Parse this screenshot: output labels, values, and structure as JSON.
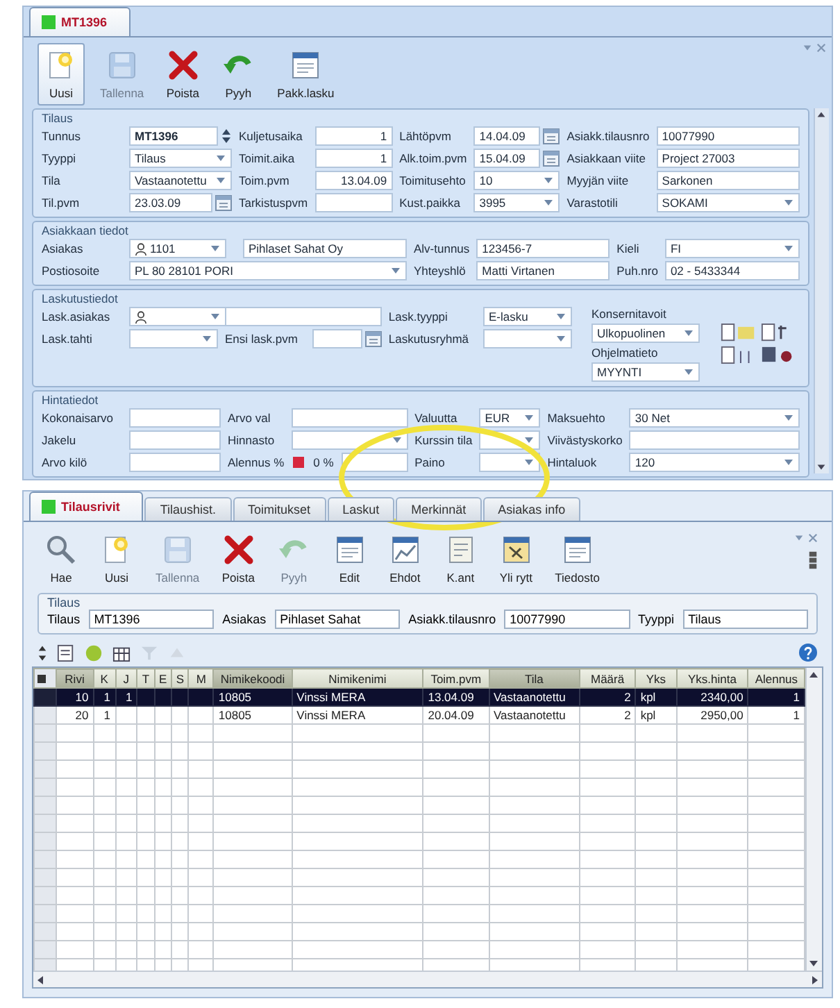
{
  "document_tabs": [
    {
      "label": "MT1396",
      "selected": true
    }
  ],
  "top_toolbar": [
    {
      "label": "Uusi",
      "pressed": true,
      "disabled": false
    },
    {
      "label": "Tallenna",
      "pressed": false,
      "disabled": true
    },
    {
      "label": "Poista",
      "pressed": false,
      "disabled": false
    },
    {
      "label": "Pyyh",
      "pressed": false,
      "disabled": false
    },
    {
      "label": "Pakk.lasku",
      "pressed": false,
      "disabled": false
    }
  ],
  "groups": [
    {
      "title": "Tilaus",
      "rows": [
        [
          {
            "kind": "label",
            "text": "Tunnus"
          },
          {
            "kind": "spin",
            "value": "MT1396"
          },
          {
            "kind": "label",
            "text": "Kuljetusaika"
          },
          {
            "kind": "number",
            "value": "1"
          },
          {
            "kind": "label",
            "text": "Lähtöpvm"
          },
          {
            "kind": "date",
            "value": "14.04.09"
          },
          {
            "kind": "label",
            "text": "Asiakk.tilausnro"
          },
          {
            "kind": "text",
            "value": "10077990"
          }
        ],
        [
          {
            "kind": "label",
            "text": "Tyyppi"
          },
          {
            "kind": "combo",
            "value": "Tilaus"
          },
          {
            "kind": "label",
            "text": "Toimit.aika"
          },
          {
            "kind": "number",
            "value": "1"
          },
          {
            "kind": "label",
            "text": "Alk.toim.pvm"
          },
          {
            "kind": "date",
            "value": "15.04.09"
          },
          {
            "kind": "label",
            "text": "Asiakkaan viite"
          },
          {
            "kind": "text",
            "value": "Project 27003"
          }
        ],
        [
          {
            "kind": "label",
            "text": "Tila"
          },
          {
            "kind": "combo",
            "value": "Vastaanotettu"
          },
          {
            "kind": "label",
            "text": "Toim.pvm"
          },
          {
            "kind": "number",
            "value": "13.04.09"
          },
          {
            "kind": "label",
            "text": "Toimitusehto"
          },
          {
            "kind": "combo",
            "value": "10"
          },
          {
            "kind": "label",
            "text": "Myyjän viite"
          },
          {
            "kind": "text",
            "value": "Sarkonen"
          }
        ],
        [
          {
            "kind": "label",
            "text": "Til.pvm"
          },
          {
            "kind": "date",
            "value": "23.03.09"
          },
          {
            "kind": "label",
            "text": "Tarkistuspvm"
          },
          {
            "kind": "text"
          },
          {
            "kind": "label",
            "text": "Kust.paikka"
          },
          {
            "kind": "combo",
            "value": "3995"
          },
          {
            "kind": "label",
            "text": "Varastotili"
          },
          {
            "kind": "combo",
            "value": "SOKAMI"
          }
        ]
      ]
    },
    {
      "title": "Asiakkaan tiedot",
      "rows": [
        [
          {
            "kind": "label",
            "text": "Asiakas"
          },
          {
            "kind": "lookup",
            "value": "1101",
            "name": "Pihlaset Sahat Oy"
          },
          {
            "kind": "label",
            "text": "Alv-tunnus"
          },
          {
            "kind": "text",
            "value": "123456-7"
          },
          {
            "kind": "label",
            "text": "Kieli"
          },
          {
            "kind": "combo",
            "value": "FI"
          }
        ],
        [
          {
            "kind": "label",
            "text": "Postiosoite"
          },
          {
            "kind": "combo",
            "value": "PL 80 28101 PORI"
          },
          {
            "kind": "label",
            "text": "Yhteyshlö"
          },
          {
            "kind": "text",
            "value": "Matti Virtanen"
          },
          {
            "kind": "label",
            "text": "Puh.nro"
          },
          {
            "kind": "text",
            "value": "02 - 5433344"
          }
        ]
      ]
    },
    {
      "title": "Laskutustiedot",
      "rows": [
        [
          {
            "kind": "label",
            "text": "Lask.asiakas"
          },
          {
            "kind": "lookup"
          },
          {
            "kind": "text"
          },
          "",
          {
            "kind": "label",
            "text": "Lask.tyyppi"
          },
          {
            "kind": "combo",
            "value": "E-lasku"
          }
        ],
        [
          {
            "kind": "label",
            "text": "Lask.tahti"
          },
          {
            "kind": "combo"
          },
          {
            "kind": "label",
            "text": "Ensi lask.pvm"
          },
          {
            "kind": "date"
          },
          {
            "kind": "label",
            "text": "Laskutusryhmä"
          },
          {
            "kind": "combo"
          }
        ]
      ],
      "side": [
        [
          {
            "kind": "label",
            "text": "Konsernitavoit"
          },
          {
            "kind": "combo",
            "value": "Ulkopuolinen"
          },
          {
            "kind": "label",
            "text": "Ohjelmatieto"
          },
          {
            "kind": "combo",
            "value": "MYYNTI"
          }
        ],
        [
          {
            "kind": "icons"
          }
        ]
      ]
    },
    {
      "title": "Hintatiedot",
      "rows": [
        [
          {
            "kind": "label",
            "text": "Kokonaisarvo"
          },
          {
            "kind": "text"
          },
          {
            "kind": "label",
            "text": "Arvo val"
          },
          {
            "kind": "text"
          },
          {
            "kind": "label",
            "text": "Valuutta"
          },
          {
            "kind": "combo",
            "value": "EUR"
          },
          {
            "kind": "label",
            "text": "Maksuehto"
          },
          {
            "kind": "combo",
            "value": "30 Net"
          }
        ],
        [
          {
            "kind": "label",
            "text": "Jakelu"
          },
          {
            "kind": "text"
          },
          {
            "kind": "label",
            "text": "Hinnasto"
          },
          {
            "kind": "combo"
          },
          {
            "kind": "label",
            "text": "Kurssin tila"
          },
          {
            "kind": "combo"
          },
          {
            "kind": "label",
            "text": "Viivästyskorko"
          },
          {
            "kind": "text"
          }
        ],
        [
          {
            "kind": "label",
            "text": "Arvo kilö"
          },
          {
            "kind": "text"
          },
          {
            "kind": "label",
            "text": "Alennus %"
          },
          {
            "kind": "flag",
            "value": "0 %"
          },
          {
            "kind": "label",
            "text": "Paino"
          },
          {
            "kind": "combo"
          },
          {
            "kind": "label",
            "text": "Hintaluok"
          },
          {
            "kind": "combo",
            "value": "120"
          }
        ]
      ]
    }
  ],
  "detail_tabs": [
    {
      "label": "Tilausrivit",
      "selected": true
    },
    {
      "label": "Tilaushist.",
      "selected": false
    },
    {
      "label": "Toimitukset",
      "selected": false
    },
    {
      "label": "Laskut",
      "selected": false
    },
    {
      "label": "Merkinnät",
      "selected": false
    },
    {
      "label": "Asiakas info",
      "selected": false
    }
  ],
  "bottom_toolbar": [
    {
      "label": "Hae",
      "pressed": false,
      "disabled": false
    },
    {
      "label": "Uusi",
      "pressed": false,
      "disabled": false
    },
    {
      "label": "Tallenna",
      "pressed": false,
      "disabled": true
    },
    {
      "label": "Poista",
      "pressed": false,
      "disabled": false
    },
    {
      "label": "Pyyh",
      "pressed": false,
      "disabled": true
    },
    {
      "label": "Edit",
      "pressed": false,
      "disabled": false
    },
    {
      "label": "Ehdot",
      "pressed": false,
      "disabled": false
    },
    {
      "label": "K.ant",
      "pressed": false,
      "disabled": false
    },
    {
      "label": "Yli rytt",
      "pressed": false,
      "disabled": false
    },
    {
      "label": "Tiedosto",
      "pressed": false,
      "disabled": false
    }
  ],
  "order_summary": {
    "title": "Tilaus",
    "fields": [
      {
        "label": "Tilaus",
        "value": "MT1396"
      },
      {
        "label": "Asiakas",
        "value": "Pihlaset Sahat"
      },
      {
        "label": "Asiakk.tilausnro",
        "value": "10077990"
      },
      {
        "label": "Tyyppi",
        "value": "Tilaus"
      }
    ]
  },
  "grid": {
    "columns": [
      {
        "label": "Rivi",
        "kind": "number",
        "highlighted": true
      },
      {
        "label": "K",
        "kind": "number",
        "highlighted": false
      },
      {
        "label": "J",
        "kind": "number",
        "highlighted": false
      },
      {
        "label": "T",
        "kind": "flag",
        "highlighted": false
      },
      {
        "label": "E",
        "kind": "flag",
        "highlighted": false
      },
      {
        "label": "S",
        "kind": "flag",
        "highlighted": false
      },
      {
        "label": "M",
        "kind": "flag",
        "highlighted": false
      },
      {
        "label": "Nimikekoodi",
        "kind": "text",
        "highlighted": true
      },
      {
        "label": "Nimikenimi",
        "kind": "text",
        "highlighted": false
      },
      {
        "label": "Toim.pvm",
        "kind": "text",
        "highlighted": false
      },
      {
        "label": "Tila",
        "kind": "text",
        "highlighted": true
      },
      {
        "label": "Määrä",
        "kind": "number",
        "highlighted": false
      },
      {
        "label": "Yks",
        "kind": "text",
        "highlighted": false
      },
      {
        "label": "Yks.hinta",
        "kind": "number",
        "highlighted": false
      },
      {
        "label": "Alennus",
        "kind": "number",
        "highlighted": false
      }
    ],
    "rows": [
      {
        "selected": true,
        "cells": [
          "10",
          "1",
          "1",
          null,
          null,
          null,
          null,
          "10805",
          "Vinssi MERA",
          "13.04.09",
          "Vastaanotettu",
          "2",
          "kpl",
          "2340,00",
          "1"
        ]
      },
      {
        "selected": false,
        "cells": [
          "20",
          "1",
          null,
          null,
          null,
          null,
          null,
          "10805",
          "Vinssi MERA",
          "20.04.09",
          "Vastaanotettu",
          "2",
          "kpl",
          "2950,00",
          "1"
        ]
      }
    ]
  },
  "annotations": [
    {
      "kind": "ellipse"
    }
  ]
}
